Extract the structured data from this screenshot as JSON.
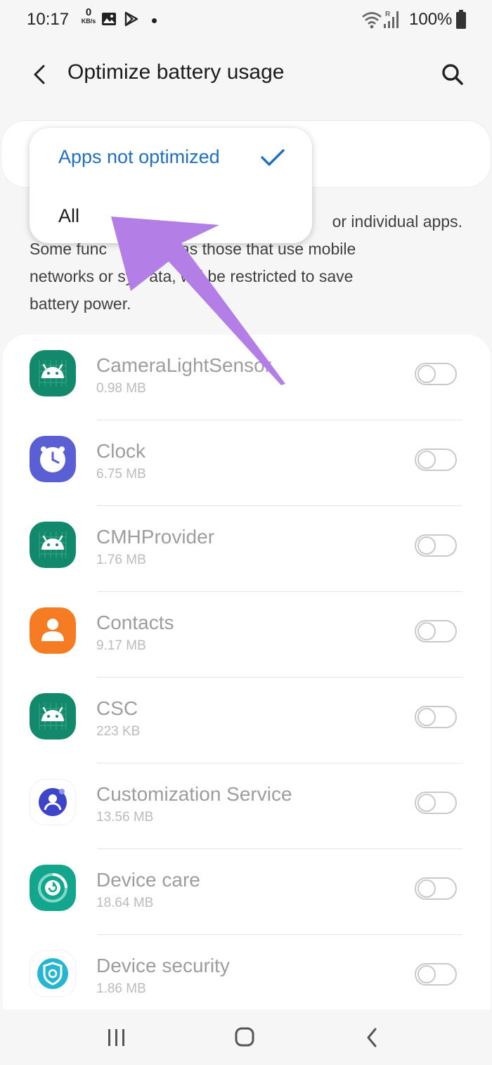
{
  "status_bar": {
    "time": "10:17",
    "net_speed_value": "0",
    "net_speed_unit": "KB/s",
    "battery_percent": "100%",
    "icons": [
      "gallery-icon",
      "play-store-icon",
      "notification-dot",
      "wifi-icon",
      "signal-icon",
      "battery-icon"
    ]
  },
  "header": {
    "title": "Optimize battery usage",
    "back_icon": "back-arrow-icon",
    "search_icon": "search-icon"
  },
  "dropdown": {
    "selected": "Apps not optimized",
    "other_option": "All",
    "accent_color": "#1f6fc2"
  },
  "description": {
    "visible_end_line1": "or individual apps.",
    "line2_part1": "Some func",
    "line2_part2": "such as those that use mobile",
    "line3_part1": "networks or sy",
    "line3_part2": "ata, will be restricted to save",
    "line4": "battery power."
  },
  "apps": [
    {
      "name": "CameraLightSensor",
      "size": "0.98 MB",
      "icon": "android-icon",
      "enabled": false
    },
    {
      "name": "Clock",
      "size": "6.75 MB",
      "icon": "clock-icon",
      "enabled": false
    },
    {
      "name": "CMHProvider",
      "size": "1.76 MB",
      "icon": "android-icon",
      "enabled": false
    },
    {
      "name": "Contacts",
      "size": "9.17 MB",
      "icon": "contacts-icon",
      "enabled": false
    },
    {
      "name": "CSC",
      "size": "223 KB",
      "icon": "android-icon",
      "enabled": false
    },
    {
      "name": "Customization Service",
      "size": "13.56 MB",
      "icon": "customization-icon",
      "enabled": false
    },
    {
      "name": "Device care",
      "size": "18.64 MB",
      "icon": "device-care-icon",
      "enabled": false
    },
    {
      "name": "Device security",
      "size": "1.86 MB",
      "icon": "device-security-icon",
      "enabled": false
    }
  ],
  "annotation": {
    "arrow_color": "#b37fe6"
  },
  "nav_bar": {
    "icons": [
      "recents-icon",
      "home-icon",
      "back-nav-icon"
    ]
  }
}
